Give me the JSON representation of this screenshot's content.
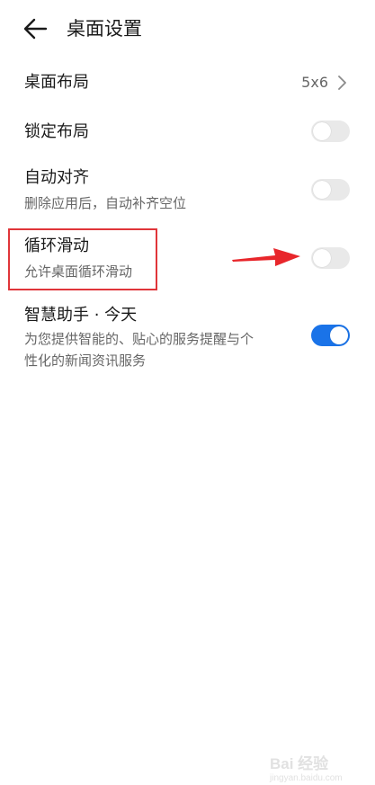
{
  "header": {
    "back_icon": "arrow-left-icon",
    "title": "桌面设置"
  },
  "settings": [
    {
      "title": "桌面布局",
      "value": "5x6",
      "control": "chevron"
    },
    {
      "title": "锁定布局",
      "control": "toggle",
      "enabled": false
    },
    {
      "title": "自动对齐",
      "subtitle": "删除应用后，自动补齐空位",
      "control": "toggle",
      "enabled": false
    },
    {
      "title": "循环滑动",
      "subtitle": "允许桌面循环滑动",
      "control": "toggle",
      "enabled": false
    },
    {
      "title": "智慧助手 · 今天",
      "subtitle_line1": "为您提供智能的、贴心的服务提醒与个",
      "subtitle_line2": "性化的新闻资讯服务",
      "control": "toggle",
      "enabled": true
    }
  ],
  "annotations": {
    "highlight_color": "#e0353a",
    "arrow_color": "#e8262b"
  },
  "colors": {
    "toggle_on": "#1a73e8",
    "toggle_off": "#e9e9e9"
  },
  "watermark": {
    "main": "Bai 经验",
    "sub": "jingyan.baidu.com"
  }
}
